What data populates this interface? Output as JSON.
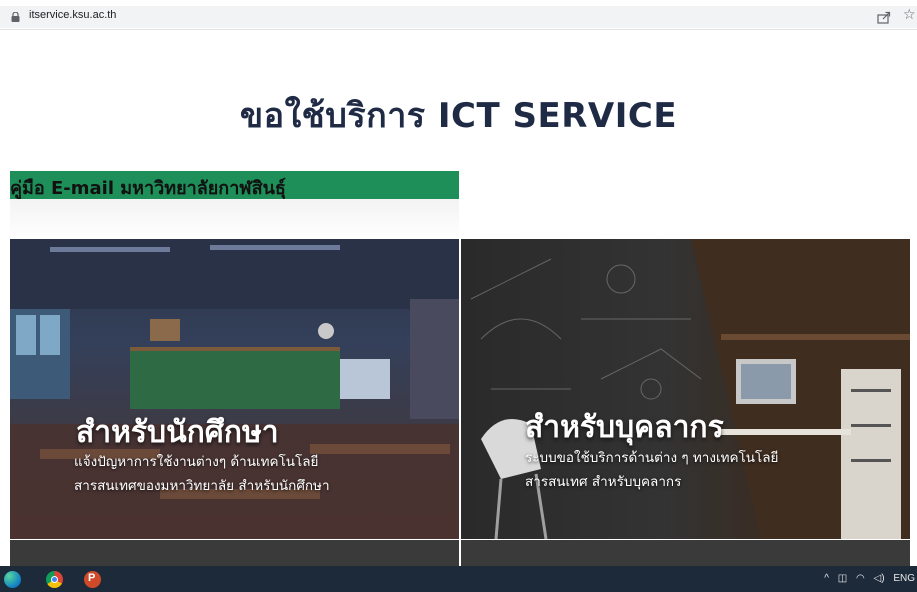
{
  "browser": {
    "url": "itservice.ksu.ac.th"
  },
  "page": {
    "title": "ขอใช้บริการ ICT SERVICE",
    "banner_label": "คู่มือ E-mail มหาวิทยาลัยกาฬสินธุ์",
    "banner_color": "#1f8f5a"
  },
  "cards": [
    {
      "title": "สำหรับนักศึกษา",
      "desc_line1": "แจ้งปัญหาการใช้งานต่างๆ ด้านเทคโนโลยี",
      "desc_line2": "สารสนเทศของมหาวิทยาลัย สำหรับนักศึกษา"
    },
    {
      "title": "สำหรับบุคลากร",
      "desc_line1": "ระบบขอใช้บริการด้านต่าง ๆ ทางเทคโนโลยี",
      "desc_line2": "สารสนเทศ สำหรับบุคลากร"
    }
  ],
  "taskbar": {
    "apps": [
      "edge-icon",
      "chrome-icon",
      "powerpoint-icon"
    ],
    "tray_language": "ENG"
  }
}
